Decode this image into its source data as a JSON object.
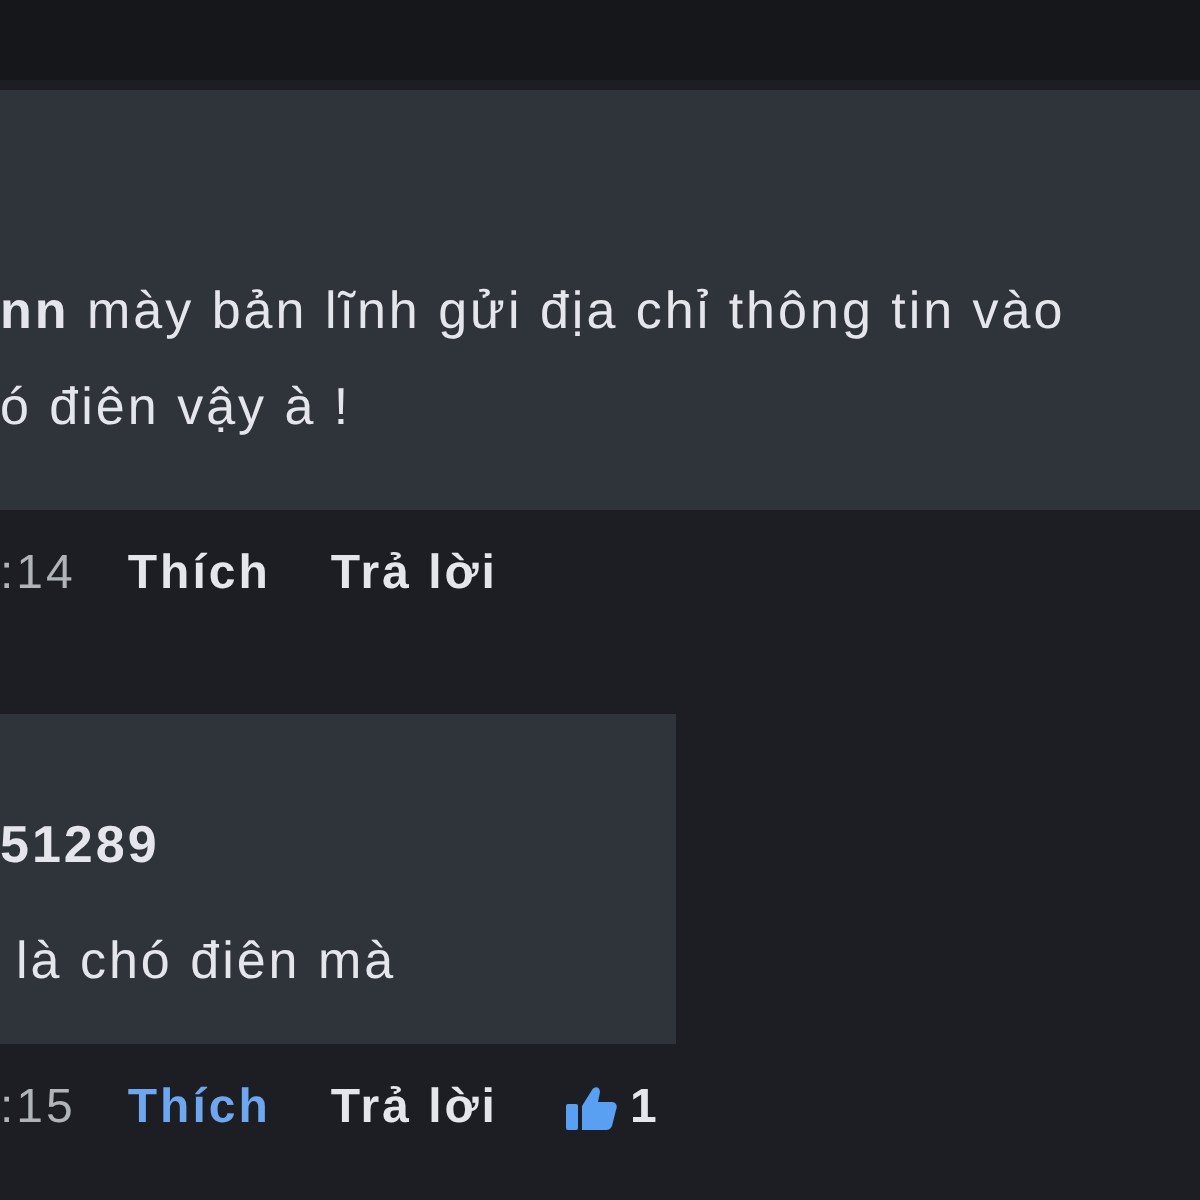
{
  "comments": [
    {
      "author": "nn",
      "text": "mày bản lĩnh gửi địa chỉ thông tin vào",
      "text_cont": "ó điên vậy à !",
      "time": ":14",
      "like_label": "Thích",
      "liked": false,
      "reply_label": "Trả lời"
    },
    {
      "author": "51289",
      "text": "là chó điên mà",
      "time": ":15",
      "like_label": "Thích",
      "liked": true,
      "reply_label": "Trả lời",
      "reactions": "1"
    }
  ]
}
